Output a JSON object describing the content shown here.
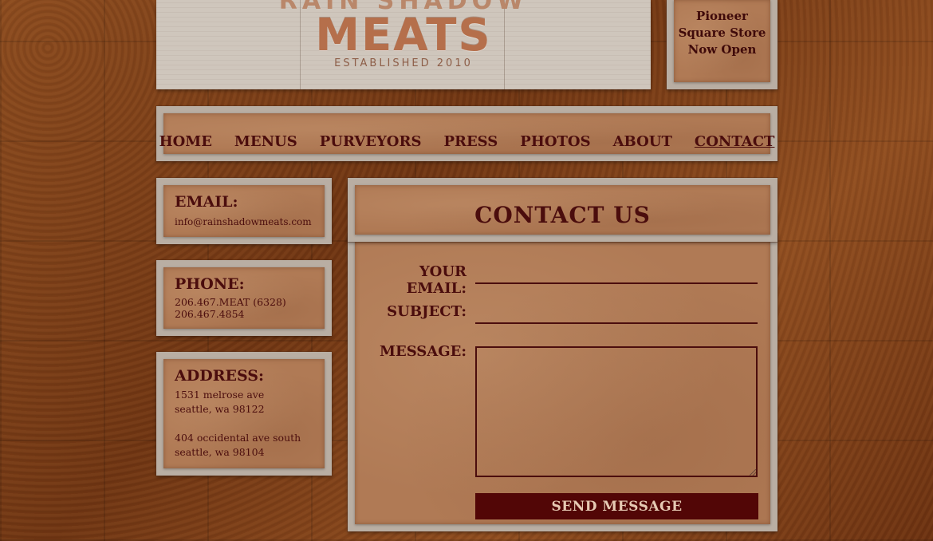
{
  "logo": {
    "top_text": "RAIN SHADOW",
    "name": "MEATS",
    "established": "ESTABLISHED 2010"
  },
  "store_notice": {
    "line1": "Pioneer",
    "line2": "Square Store",
    "line3": "Now Open"
  },
  "nav": {
    "items": [
      {
        "label": "HOME"
      },
      {
        "label": "MENUS"
      },
      {
        "label": "PURVEYORS"
      },
      {
        "label": "PRESS"
      },
      {
        "label": "PHOTOS"
      },
      {
        "label": "ABOUT"
      },
      {
        "label": "CONTACT"
      }
    ],
    "active": "CONTACT"
  },
  "email_box": {
    "title": "EMAIL:",
    "address": "info@rainshadowmeats.com"
  },
  "phone_box": {
    "title": "PHONE:",
    "line1": "206.467.MEAT (6328)",
    "line2": "206.467.4854"
  },
  "address_box": {
    "title": "ADDRESS:",
    "loc1_line1": "1531 melrose ave",
    "loc1_line2": "seattle, wa 98122",
    "loc2_line1": "404 occidental ave south",
    "loc2_line2": "seattle, wa 98104"
  },
  "contact": {
    "title": "CONTACT  US",
    "email_label": "YOUR EMAIL:",
    "email_value": "",
    "subject_label": "SUBJECT:",
    "subject_value": "",
    "message_label": "MESSAGE:",
    "message_value": "",
    "send_label": "SEND MESSAGE"
  },
  "colors": {
    "text_dark": "#4b0d0d",
    "button_bg": "#520606",
    "paper": "#b07a55",
    "frame": "#b9aea3"
  }
}
